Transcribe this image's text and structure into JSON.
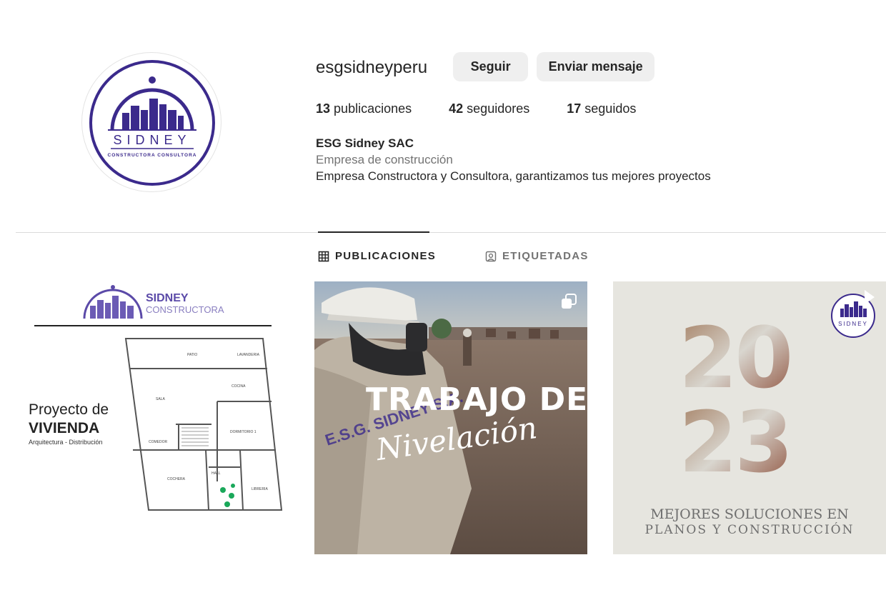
{
  "profile": {
    "username": "esgsidneyperu",
    "follow_label": "Seguir",
    "message_label": "Enviar mensaje",
    "stats": {
      "posts_count": "13",
      "posts_label": "publicaciones",
      "followers_count": "42",
      "followers_label": "seguidores",
      "following_count": "17",
      "following_label": "seguidos"
    },
    "display_name": "ESG Sidney SAC",
    "category": "Empresa de construcción",
    "bio": "Empresa Constructora y Consultora, garantizamos tus mejores proyectos"
  },
  "avatar": {
    "brand": "SIDNEY",
    "tagline": "CONSTRUCTORA CONSULTORA",
    "color": "#3b2a8c"
  },
  "tabs": [
    {
      "label": "PUBLICACIONES",
      "icon": "grid-icon",
      "active": true
    },
    {
      "label": "ETIQUETADAS",
      "icon": "tagged-user-icon",
      "active": false
    }
  ],
  "posts": [
    {
      "brand_name": "SIDNEY",
      "brand_sub": "CONSTRUCTORA",
      "headline_1": "Proyecto de",
      "headline_2": "VIVIENDA",
      "subline": "Arquitectura - Distribución",
      "rooms": [
        "PATIO",
        "LAVANDERIA",
        "COCINA",
        "SALA",
        "DORMITORIO 1",
        "COMEDOR",
        "COCHERA",
        "HALL",
        "LIBRERIA"
      ]
    },
    {
      "title_1": "TRABAJO DE",
      "title_2": "Nivelación",
      "vest_text": "E.S.G. SIDNEY S.A.",
      "icon": "multiple-photos-icon"
    },
    {
      "year_top": "20",
      "year_bottom": "23",
      "caption_1": "MEJORES SOLUCIONES EN",
      "caption_2": "PLANOS Y CONSTRUCCIÓN",
      "logo_text": "SIDNEY",
      "icon": "reel-icon"
    }
  ],
  "colors": {
    "brand_purple": "#3b2a8c",
    "button_bg": "#efefef",
    "muted_text": "#737373",
    "divider": "#dbdbdb"
  }
}
